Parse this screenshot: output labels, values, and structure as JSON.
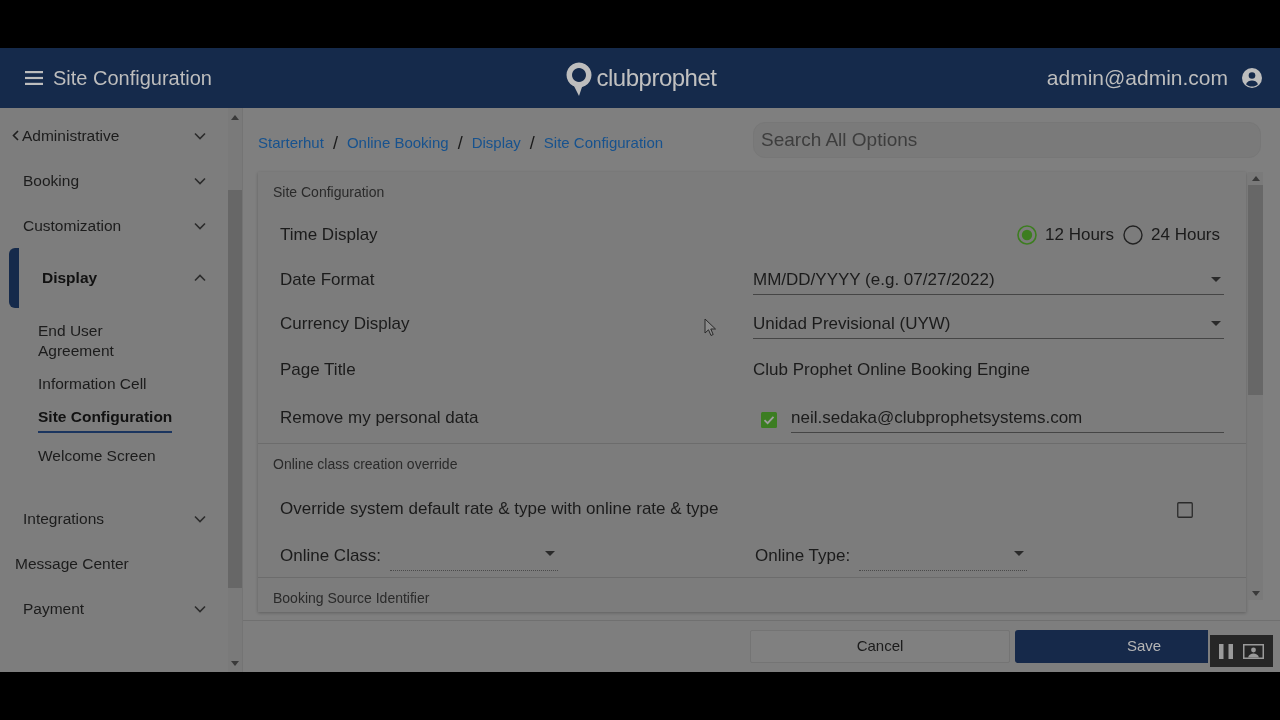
{
  "header": {
    "title": "Site Configuration",
    "logo_text": "clubprophet",
    "user_email": "admin@admin.com"
  },
  "sidebar": {
    "items": [
      {
        "kind": "back",
        "label": "Administrative",
        "expanded": false,
        "selected": false
      },
      {
        "kind": "group",
        "label": "Booking",
        "expanded": false,
        "selected": false
      },
      {
        "kind": "group",
        "label": "Customization",
        "expanded": false,
        "selected": false
      },
      {
        "kind": "group",
        "label": "Display",
        "expanded": true,
        "selected": true,
        "children": [
          {
            "label": "End User\nAgreement",
            "selected": false
          },
          {
            "label": "Information Cell",
            "selected": false
          },
          {
            "label": "Site Configuration",
            "selected": true
          },
          {
            "label": "Welcome Screen",
            "selected": false
          }
        ]
      },
      {
        "kind": "group",
        "label": "Integrations",
        "expanded": false,
        "selected": false
      },
      {
        "kind": "link",
        "label": "Message Center",
        "selected": false
      },
      {
        "kind": "group",
        "label": "Payment",
        "expanded": false,
        "selected": false
      }
    ]
  },
  "breadcrumb": [
    {
      "kind": "link",
      "text": "Starterhut"
    },
    {
      "kind": "separator",
      "text": "/"
    },
    {
      "kind": "link",
      "text": "Online Booking"
    },
    {
      "kind": "separator",
      "text": "/"
    },
    {
      "kind": "link",
      "text": "Display"
    },
    {
      "kind": "separator",
      "text": "/"
    },
    {
      "kind": "link",
      "text": "Site Configuration"
    }
  ],
  "search": {
    "placeholder": "Search All Options"
  },
  "sections": [
    {
      "title": "Site Configuration",
      "rows": [
        {
          "kind": "radio",
          "label": "Time Display",
          "options": [
            {
              "label": "12 Hours",
              "selected": true
            },
            {
              "label": "24 Hours",
              "selected": false
            }
          ]
        },
        {
          "kind": "select",
          "label": "Date Format",
          "value": "MM/DD/YYYY (e.g. 07/27/2022)"
        },
        {
          "kind": "select",
          "label": "Currency Display",
          "value": "Unidad Previsional (UYW)"
        },
        {
          "kind": "text",
          "label": "Page Title",
          "value": "Club Prophet Online Booking Engine"
        },
        {
          "kind": "checkbox_input",
          "label": "Remove my personal data",
          "checked": true,
          "value": "neil.sedaka@clubprophetsystems.com"
        }
      ]
    },
    {
      "title": "Online class creation override",
      "rows": [
        {
          "kind": "checkbox",
          "label": "Override system default rate & type with online rate & type",
          "checked": false
        },
        {
          "kind": "select_pair",
          "fields": [
            {
              "label": "Online Class:"
            },
            {
              "label": "Online Type:"
            }
          ]
        }
      ]
    },
    {
      "title": "Booking Source Identifier"
    }
  ],
  "footer": {
    "buttons": [
      {
        "kind": "secondary",
        "label": "Cancel"
      },
      {
        "kind": "primary",
        "label": "Save"
      }
    ]
  }
}
